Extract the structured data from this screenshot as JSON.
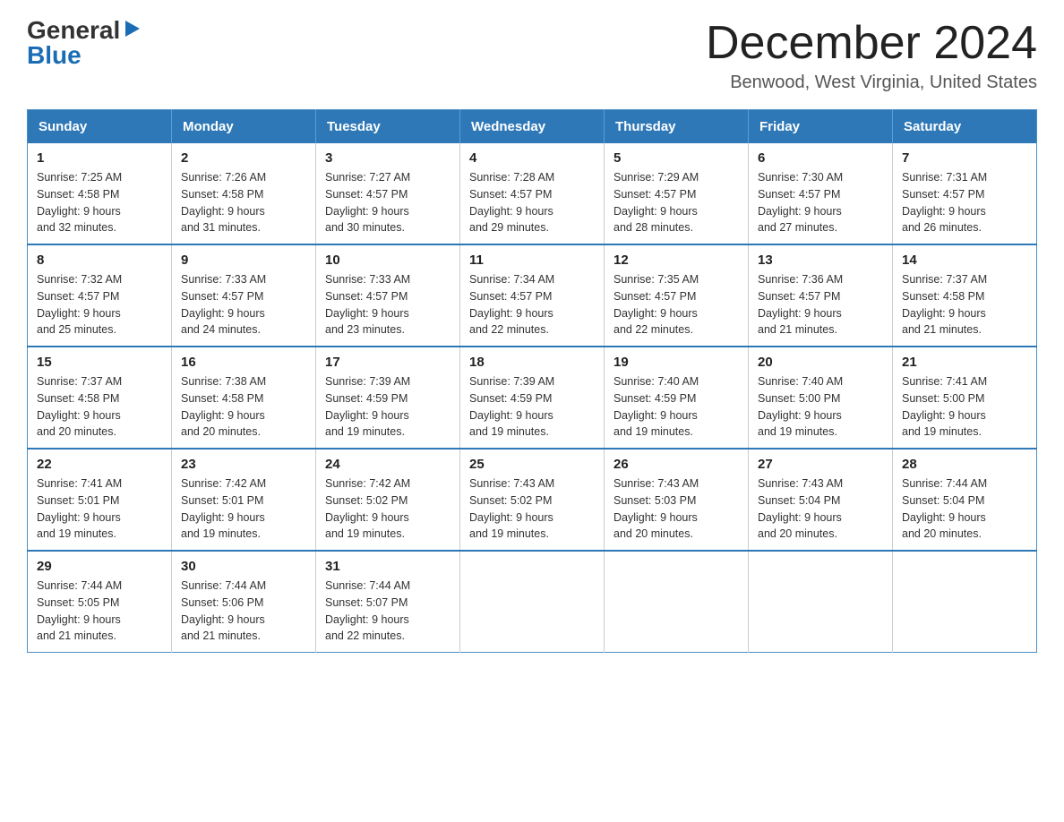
{
  "header": {
    "logo_general": "General",
    "logo_blue": "Blue",
    "month_title": "December 2024",
    "location": "Benwood, West Virginia, United States"
  },
  "days_of_week": [
    "Sunday",
    "Monday",
    "Tuesday",
    "Wednesday",
    "Thursday",
    "Friday",
    "Saturday"
  ],
  "weeks": [
    [
      {
        "day": "1",
        "sunrise": "7:25 AM",
        "sunset": "4:58 PM",
        "daylight": "9 hours and 32 minutes."
      },
      {
        "day": "2",
        "sunrise": "7:26 AM",
        "sunset": "4:58 PM",
        "daylight": "9 hours and 31 minutes."
      },
      {
        "day": "3",
        "sunrise": "7:27 AM",
        "sunset": "4:57 PM",
        "daylight": "9 hours and 30 minutes."
      },
      {
        "day": "4",
        "sunrise": "7:28 AM",
        "sunset": "4:57 PM",
        "daylight": "9 hours and 29 minutes."
      },
      {
        "day": "5",
        "sunrise": "7:29 AM",
        "sunset": "4:57 PM",
        "daylight": "9 hours and 28 minutes."
      },
      {
        "day": "6",
        "sunrise": "7:30 AM",
        "sunset": "4:57 PM",
        "daylight": "9 hours and 27 minutes."
      },
      {
        "day": "7",
        "sunrise": "7:31 AM",
        "sunset": "4:57 PM",
        "daylight": "9 hours and 26 minutes."
      }
    ],
    [
      {
        "day": "8",
        "sunrise": "7:32 AM",
        "sunset": "4:57 PM",
        "daylight": "9 hours and 25 minutes."
      },
      {
        "day": "9",
        "sunrise": "7:33 AM",
        "sunset": "4:57 PM",
        "daylight": "9 hours and 24 minutes."
      },
      {
        "day": "10",
        "sunrise": "7:33 AM",
        "sunset": "4:57 PM",
        "daylight": "9 hours and 23 minutes."
      },
      {
        "day": "11",
        "sunrise": "7:34 AM",
        "sunset": "4:57 PM",
        "daylight": "9 hours and 22 minutes."
      },
      {
        "day": "12",
        "sunrise": "7:35 AM",
        "sunset": "4:57 PM",
        "daylight": "9 hours and 22 minutes."
      },
      {
        "day": "13",
        "sunrise": "7:36 AM",
        "sunset": "4:57 PM",
        "daylight": "9 hours and 21 minutes."
      },
      {
        "day": "14",
        "sunrise": "7:37 AM",
        "sunset": "4:58 PM",
        "daylight": "9 hours and 21 minutes."
      }
    ],
    [
      {
        "day": "15",
        "sunrise": "7:37 AM",
        "sunset": "4:58 PM",
        "daylight": "9 hours and 20 minutes."
      },
      {
        "day": "16",
        "sunrise": "7:38 AM",
        "sunset": "4:58 PM",
        "daylight": "9 hours and 20 minutes."
      },
      {
        "day": "17",
        "sunrise": "7:39 AM",
        "sunset": "4:59 PM",
        "daylight": "9 hours and 19 minutes."
      },
      {
        "day": "18",
        "sunrise": "7:39 AM",
        "sunset": "4:59 PM",
        "daylight": "9 hours and 19 minutes."
      },
      {
        "day": "19",
        "sunrise": "7:40 AM",
        "sunset": "4:59 PM",
        "daylight": "9 hours and 19 minutes."
      },
      {
        "day": "20",
        "sunrise": "7:40 AM",
        "sunset": "5:00 PM",
        "daylight": "9 hours and 19 minutes."
      },
      {
        "day": "21",
        "sunrise": "7:41 AM",
        "sunset": "5:00 PM",
        "daylight": "9 hours and 19 minutes."
      }
    ],
    [
      {
        "day": "22",
        "sunrise": "7:41 AM",
        "sunset": "5:01 PM",
        "daylight": "9 hours and 19 minutes."
      },
      {
        "day": "23",
        "sunrise": "7:42 AM",
        "sunset": "5:01 PM",
        "daylight": "9 hours and 19 minutes."
      },
      {
        "day": "24",
        "sunrise": "7:42 AM",
        "sunset": "5:02 PM",
        "daylight": "9 hours and 19 minutes."
      },
      {
        "day": "25",
        "sunrise": "7:43 AM",
        "sunset": "5:02 PM",
        "daylight": "9 hours and 19 minutes."
      },
      {
        "day": "26",
        "sunrise": "7:43 AM",
        "sunset": "5:03 PM",
        "daylight": "9 hours and 20 minutes."
      },
      {
        "day": "27",
        "sunrise": "7:43 AM",
        "sunset": "5:04 PM",
        "daylight": "9 hours and 20 minutes."
      },
      {
        "day": "28",
        "sunrise": "7:44 AM",
        "sunset": "5:04 PM",
        "daylight": "9 hours and 20 minutes."
      }
    ],
    [
      {
        "day": "29",
        "sunrise": "7:44 AM",
        "sunset": "5:05 PM",
        "daylight": "9 hours and 21 minutes."
      },
      {
        "day": "30",
        "sunrise": "7:44 AM",
        "sunset": "5:06 PM",
        "daylight": "9 hours and 21 minutes."
      },
      {
        "day": "31",
        "sunrise": "7:44 AM",
        "sunset": "5:07 PM",
        "daylight": "9 hours and 22 minutes."
      },
      null,
      null,
      null,
      null
    ]
  ]
}
